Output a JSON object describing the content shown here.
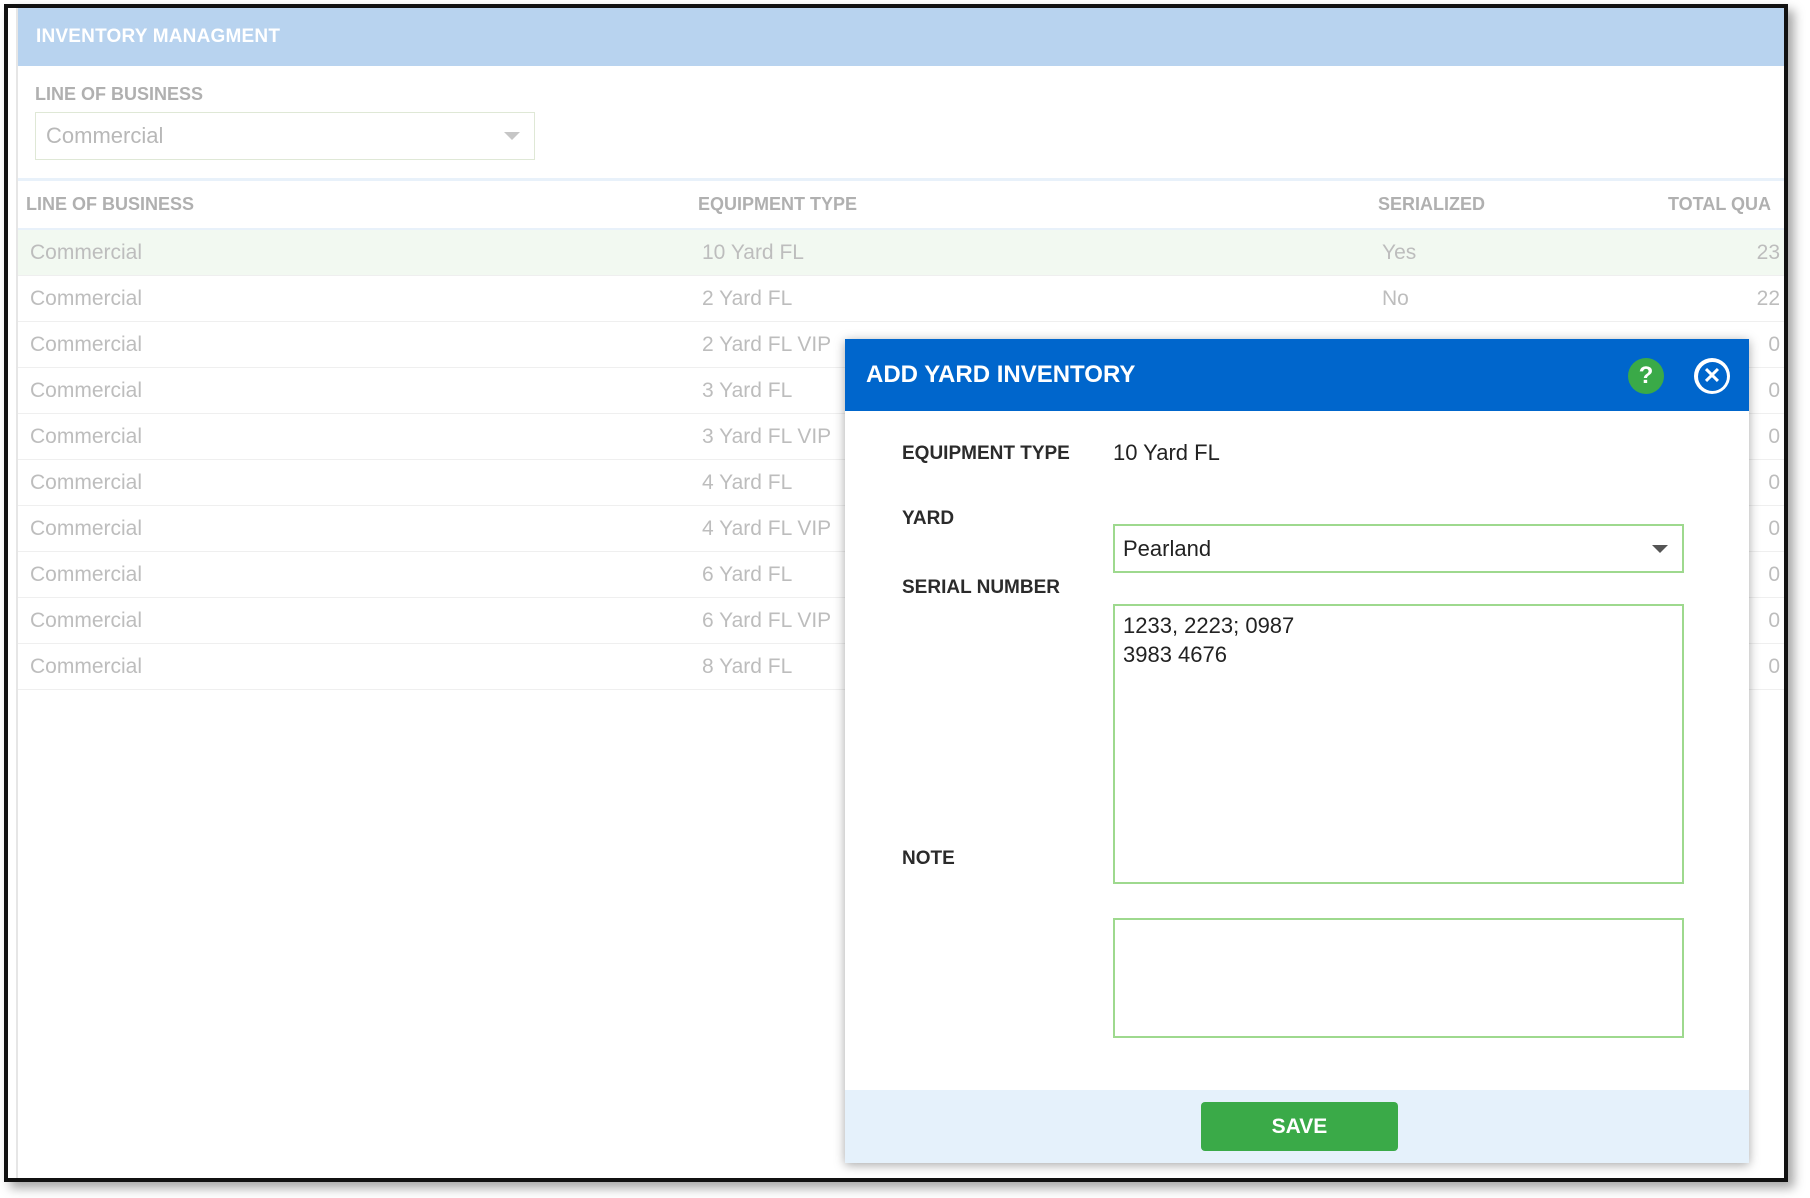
{
  "page": {
    "title": "INVENTORY MANAGMENT",
    "filter_label": "LINE OF BUSINESS",
    "filter_value": "Commercial"
  },
  "grid": {
    "columns": [
      "LINE OF BUSINESS",
      "EQUIPMENT TYPE",
      "SERIALIZED",
      "TOTAL QUA"
    ],
    "rows": [
      {
        "lob": "Commercial",
        "equipment": "10 Yard FL",
        "serialized": "Yes",
        "total": "23"
      },
      {
        "lob": "Commercial",
        "equipment": "2 Yard FL",
        "serialized": "No",
        "total": "22"
      },
      {
        "lob": "Commercial",
        "equipment": "2 Yard FL VIP",
        "serialized": "",
        "total": "0"
      },
      {
        "lob": "Commercial",
        "equipment": "3 Yard FL",
        "serialized": "",
        "total": "0"
      },
      {
        "lob": "Commercial",
        "equipment": "3 Yard FL VIP",
        "serialized": "",
        "total": "0"
      },
      {
        "lob": "Commercial",
        "equipment": "4 Yard FL",
        "serialized": "",
        "total": "0"
      },
      {
        "lob": "Commercial",
        "equipment": "4 Yard FL VIP",
        "serialized": "",
        "total": "0"
      },
      {
        "lob": "Commercial",
        "equipment": "6 Yard FL",
        "serialized": "",
        "total": "0"
      },
      {
        "lob": "Commercial",
        "equipment": "6 Yard FL VIP",
        "serialized": "",
        "total": "0"
      },
      {
        "lob": "Commercial",
        "equipment": "8 Yard FL",
        "serialized": "",
        "total": "0"
      }
    ]
  },
  "modal": {
    "title": "ADD YARD INVENTORY",
    "help_icon": "?",
    "close_icon": "✕",
    "equipment_type_label": "EQUIPMENT TYPE",
    "equipment_type_value": "10 Yard FL",
    "yard_label": "YARD",
    "yard_value": "Pearland",
    "serial_label": "SERIAL NUMBER",
    "serial_value": "1233, 2223; 0987\n3983 4676",
    "note_label": "NOTE",
    "note_value": "",
    "save_label": "SAVE"
  },
  "colors": {
    "header_bg": "#b8d3ef",
    "modal_header": "#0066cc",
    "accent_green": "#3aaa48",
    "input_border": "#9ed98e",
    "footer_bg": "#e5f1fb"
  },
  "icons": {
    "help": "help-icon",
    "close": "close-icon",
    "dropdown": "chevron-down-icon"
  }
}
